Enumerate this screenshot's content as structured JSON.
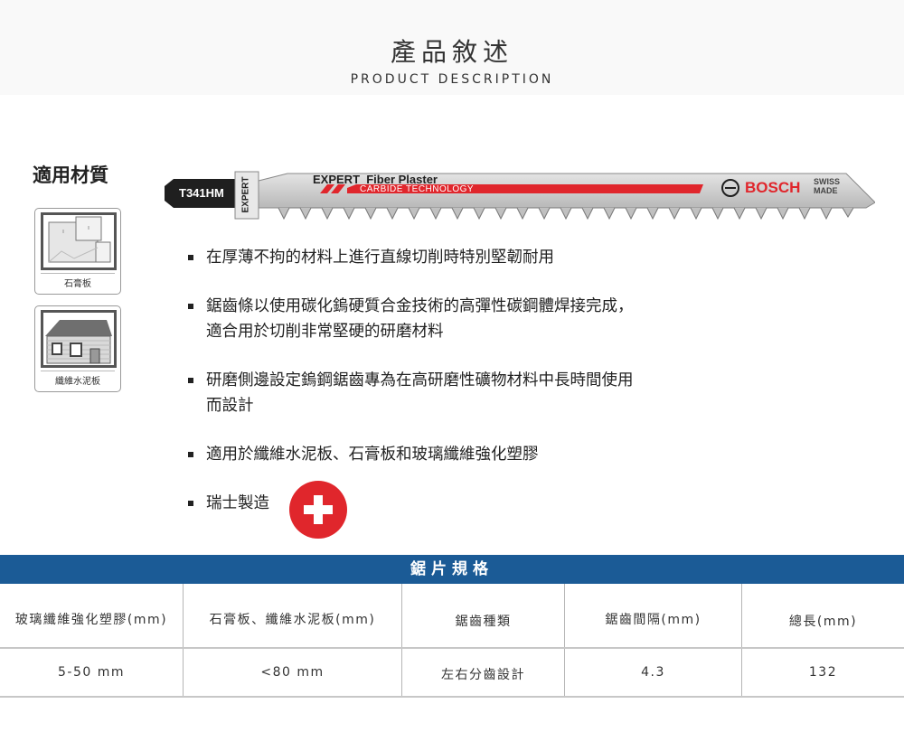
{
  "header": {
    "title_zh": "產品敘述",
    "title_en": "PRODUCT DESCRIPTION"
  },
  "materials": {
    "title": "適用材質",
    "items": [
      {
        "label": "石膏板"
      },
      {
        "label": "纖維水泥板"
      }
    ]
  },
  "blade": {
    "model": "T341HM",
    "expert_side": "EXPERT",
    "line": "EXPERT  Fiber Plaster",
    "tech": "CARBIDE TECHNOLOGY",
    "brand": "BOSCH",
    "made_1": "SWISS",
    "made_2": "MADE",
    "colors": {
      "blade": "#c9c9c9",
      "accent": "#e0262c",
      "shank": "#1f1f1f"
    }
  },
  "bullets": [
    {
      "line1": "在厚薄不拘的材料上進行直線切削時特別堅韌耐用",
      "line2": ""
    },
    {
      "line1": "鋸齒條以使用碳化鎢硬質合金技術的高彈性碳鋼體焊接完成，",
      "line2": "適合用於切削非常堅硬的研磨材料"
    },
    {
      "line1": "研磨側邊設定鎢鋼鋸齒專為在高研磨性礦物材料中長時間使用",
      "line2": "而設計"
    },
    {
      "line1": "適用於纖維水泥板、石膏板和玻璃纖維強化塑膠",
      "line2": ""
    },
    {
      "line1": "瑞士製造",
      "line2": ""
    }
  ],
  "swiss_flag": {
    "color": "#e0262c",
    "icon": "swiss-cross-icon"
  },
  "spec": {
    "title": "鋸片規格",
    "bar_color": "#1b5b96",
    "headers": [
      "玻璃纖維強化塑膠(mm)",
      "石膏板、纖維水泥板(mm)",
      "鋸齒種類",
      "鋸齒間隔(mm)",
      "總長(mm)"
    ],
    "values": [
      "5-50 mm",
      "<80 mm",
      "左右分齒設計",
      "4.3",
      "132"
    ]
  }
}
